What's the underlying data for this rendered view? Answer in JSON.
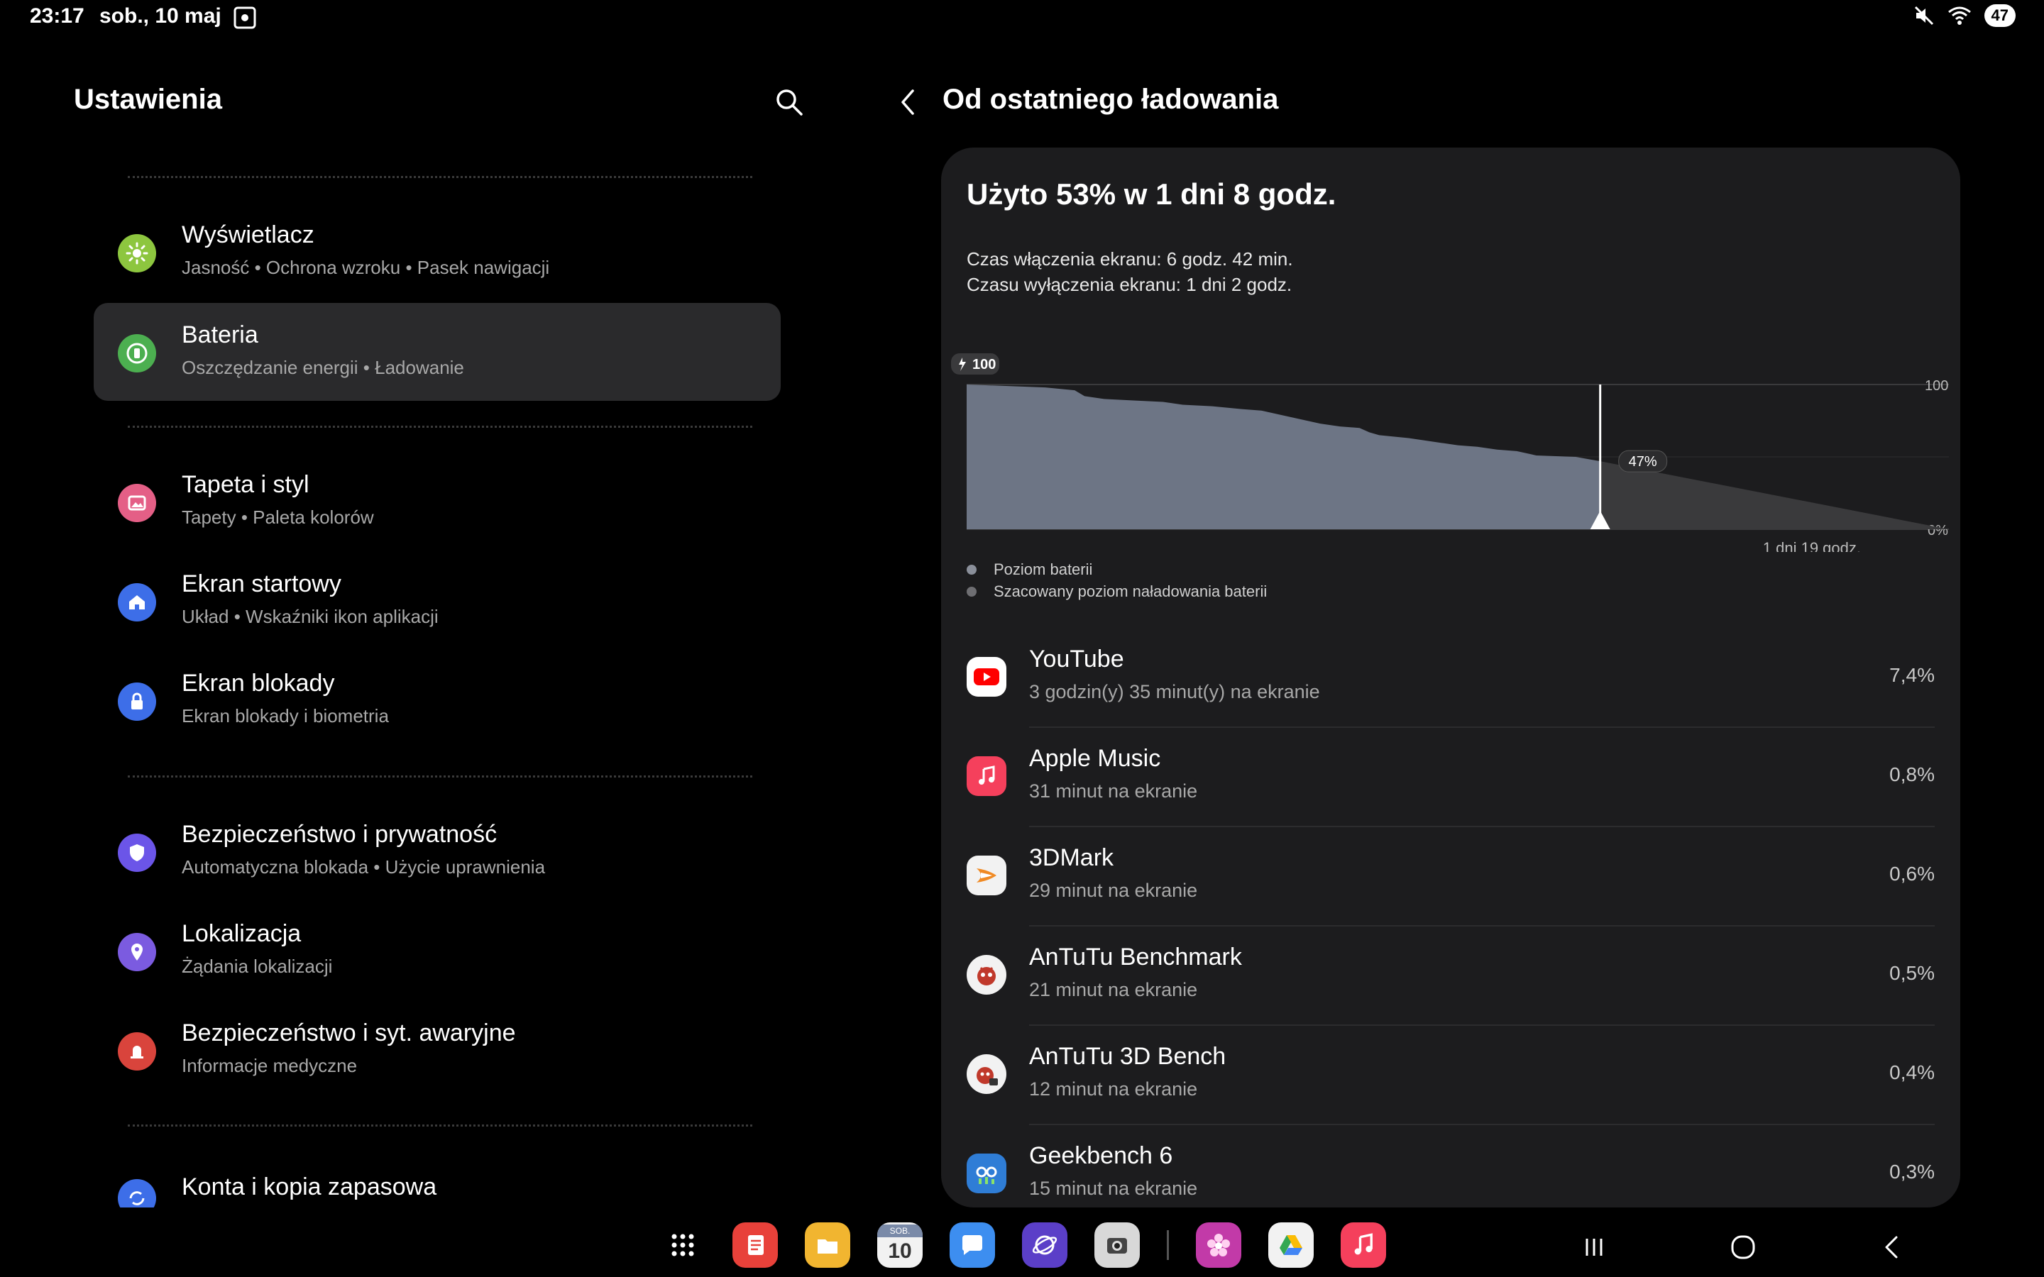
{
  "status_bar": {
    "time": "23:17",
    "date": "sob., 10 maj",
    "battery": "47"
  },
  "settings": {
    "title": "Ustawienia",
    "items": [
      {
        "title": "Wyświetlacz",
        "subtitle": "Jasność  •  Ochrona wzroku  •  Pasek nawigacji",
        "icon": "sun-icon",
        "color": "#8dc63f"
      },
      {
        "title": "Bateria",
        "subtitle": "Oszczędzanie energii  •  Ładowanie",
        "icon": "battery-icon",
        "color": "#4caf50"
      },
      {
        "title": "Tapeta i styl",
        "subtitle": "Tapety  •  Paleta kolorów",
        "icon": "wallpaper-icon",
        "color": "#e45f86"
      },
      {
        "title": "Ekran startowy",
        "subtitle": "Układ  •  Wskaźniki ikon aplikacji",
        "icon": "home-icon",
        "color": "#3d6ee8"
      },
      {
        "title": "Ekran blokady",
        "subtitle": "Ekran blokady i biometria",
        "icon": "lock-icon",
        "color": "#3d6ee8"
      },
      {
        "title": "Bezpieczeństwo i prywatność",
        "subtitle": "Automatyczna blokada  •  Użycie uprawnienia",
        "icon": "shield-icon",
        "color": "#6b55e8"
      },
      {
        "title": "Lokalizacja",
        "subtitle": "Żądania lokalizacji",
        "icon": "location-pin-icon",
        "color": "#7b5be0"
      },
      {
        "title": "Bezpieczeństwo i syt. awaryjne",
        "subtitle": "Informacje medyczne",
        "icon": "emergency-icon",
        "color": "#d9443c"
      },
      {
        "title": "Konta i kopia zapasowa",
        "subtitle": "",
        "icon": "sync-icon",
        "color": "#3d6ee8"
      }
    ]
  },
  "battery_detail": {
    "title": "Od ostatniego ładowania",
    "headline": "Użyto 53% w 1 dni 8 godz.",
    "screen_on": "Czas włączenia ekranu: 6 godz. 42 min.",
    "screen_off": "Czasu wyłączenia ekranu: 1 dni 2 godz.",
    "legend": [
      {
        "label": "Poziom baterii",
        "color": "#8a8f9a"
      },
      {
        "label": "Szacowany poziom naładowania baterii",
        "color": "#6e6e72"
      }
    ],
    "apps": [
      {
        "name": "YouTube",
        "usage": "3 godzin(y) 35 minut(y) na ekranie",
        "percent": "7,4%",
        "icon": "youtube-icon"
      },
      {
        "name": "Apple Music",
        "usage": "31 minut na ekranie",
        "percent": "0,8%",
        "icon": "apple-music-icon"
      },
      {
        "name": "3DMark",
        "usage": "29 minut na ekranie",
        "percent": "0,6%",
        "icon": "3dmark-icon"
      },
      {
        "name": "AnTuTu Benchmark",
        "usage": "21 minut na ekranie",
        "percent": "0,5%",
        "icon": "antutu-icon"
      },
      {
        "name": "AnTuTu 3D Bench",
        "usage": "12 minut na ekranie",
        "percent": "0,4%",
        "icon": "antutu-3d-icon"
      },
      {
        "name": "Geekbench 6",
        "usage": "15 minut na ekranie",
        "percent": "0,3%",
        "icon": "geekbench-icon"
      }
    ]
  },
  "chart_data": {
    "type": "area",
    "charge_label": "100",
    "y_tick_labels": [
      "100",
      "0%"
    ],
    "x_end_label": "1 dni 19 godz.",
    "current_marker_label": "47%",
    "ylim": [
      0,
      100
    ],
    "series": [
      {
        "name": "Poziom baterii",
        "points": [
          [
            0,
            100
          ],
          [
            0.04,
            99
          ],
          [
            0.08,
            98
          ],
          [
            0.11,
            96
          ],
          [
            0.12,
            92
          ],
          [
            0.14,
            90
          ],
          [
            0.17,
            89
          ],
          [
            0.2,
            88
          ],
          [
            0.22,
            86
          ],
          [
            0.25,
            85
          ],
          [
            0.28,
            83
          ],
          [
            0.3,
            82
          ],
          [
            0.32,
            79
          ],
          [
            0.34,
            76
          ],
          [
            0.36,
            73
          ],
          [
            0.38,
            71
          ],
          [
            0.4,
            70
          ],
          [
            0.41,
            67
          ],
          [
            0.42,
            65
          ],
          [
            0.45,
            63
          ],
          [
            0.48,
            60
          ],
          [
            0.5,
            58
          ],
          [
            0.52,
            57
          ],
          [
            0.54,
            55
          ],
          [
            0.56,
            54
          ],
          [
            0.58,
            51
          ],
          [
            0.62,
            50
          ],
          [
            0.645,
            47
          ]
        ]
      },
      {
        "name": "Szacowany poziom naładowania baterii",
        "points": [
          [
            0.645,
            47
          ],
          [
            1.0,
            0
          ]
        ]
      }
    ]
  },
  "dock": {
    "day_abbr": "SOB.",
    "day_num": "10",
    "apps": [
      "apps-grid-icon",
      "notes-icon",
      "files-icon",
      "calendar-icon",
      "messages-icon",
      "browser-icon",
      "camera-icon",
      "photos-icon",
      "drive-icon",
      "music-icon"
    ]
  },
  "colors": {
    "background": "#000000",
    "card": "#1c1c1e",
    "selected_item": "#2a2a2c",
    "chart_fill": "#6d7585",
    "chart_estimate": "#3a3a3c"
  }
}
